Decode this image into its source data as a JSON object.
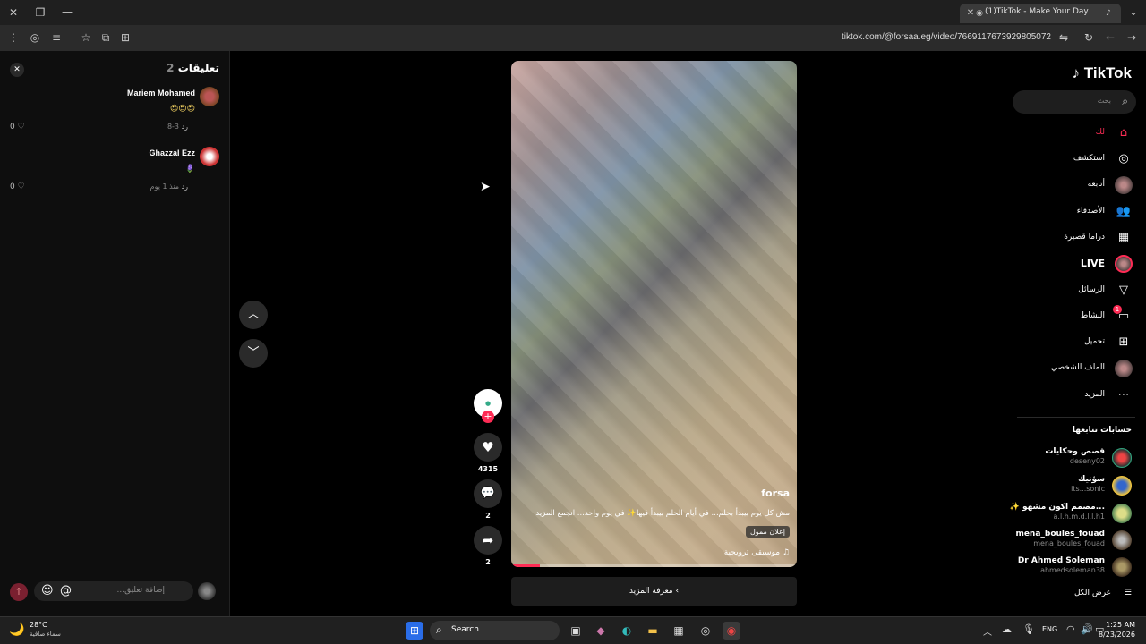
{
  "browser": {
    "tab_title": "(1)TikTok - Make Your Day",
    "url": "tiktok.com/@forsaa.eg/video/7669117673929805072"
  },
  "comments": {
    "title": "تعليقات",
    "count": "2",
    "items": [
      {
        "name": "Mariem Mohamed",
        "text": "😍😍😍",
        "time": "3-8",
        "reply": "رد",
        "likes": "0"
      },
      {
        "name": "Ghazzal Ezz",
        "text": "🪻",
        "time": "منذ 1 يوم",
        "reply": "رد",
        "likes": "0"
      }
    ],
    "placeholder": "...إضافة تعليق"
  },
  "video": {
    "author": "forsa",
    "caption": "مش كل يوم بيبدأ بحلم... في أيام الحلم بيبدأ فيها✨ في يوم واحد... انجمع المزيد",
    "sponsored": "إعلان ممول",
    "music": "موسيقى ترويجية",
    "progress": 0.1,
    "see_more": "معرفة المزيد"
  },
  "actions": {
    "likes": "4315",
    "comments": "2",
    "shares": "2"
  },
  "sidebar": {
    "logo": "TikTok",
    "search_placeholder": "بحث",
    "nav": [
      {
        "label": "لك",
        "icon": "home-icon"
      },
      {
        "label": "استكشف",
        "icon": "compass-icon"
      },
      {
        "label": "أتابعه",
        "icon": "avatar-icon"
      },
      {
        "label": "الأصدقاء",
        "icon": "friends-icon"
      },
      {
        "label": "دراما قصيرة",
        "icon": "film-icon"
      },
      {
        "label": "LIVE",
        "icon": "live-icon"
      },
      {
        "label": "الرسائل",
        "icon": "send-icon"
      },
      {
        "label": "النشاط",
        "icon": "activity-icon"
      },
      {
        "label": "تحميل",
        "icon": "upload-icon"
      },
      {
        "label": "الملف الشخصي",
        "icon": "profile-icon"
      },
      {
        "label": "المزيد",
        "icon": "more-icon"
      }
    ],
    "activity_badge": "1",
    "following_title": "حسابات تتابعها",
    "following": [
      {
        "name": "قصص وحكايات",
        "handle": "deseny02"
      },
      {
        "name": "سؤنيك",
        "handle": "its...sonic"
      },
      {
        "name": "✨ مصمم اكون مشهو...",
        "handle": "a.l.h.m.d.l.l.h1"
      },
      {
        "name": "mena_boules_fouad",
        "handle": "mena_boules_fouad"
      },
      {
        "name": "Dr Ahmed Soleman",
        "handle": "ahmedsoleman38"
      }
    ],
    "see_all": "عرض الكل"
  },
  "taskbar": {
    "weather_temp": "28°C",
    "weather_desc": "سماء صافية",
    "search_label": "Search",
    "lang": "ENG",
    "time": "1:25 AM",
    "date": "8/23/2026"
  }
}
